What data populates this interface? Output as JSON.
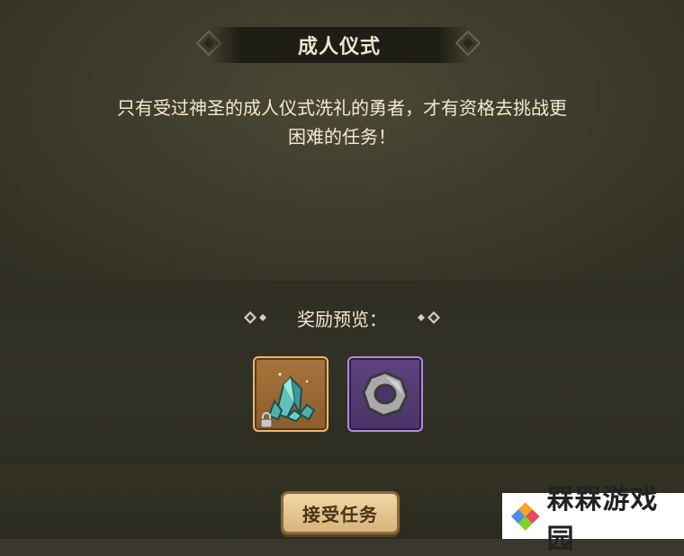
{
  "dialog": {
    "title": "成人仪式",
    "description_line1": "只有受过神圣的成人仪式洗礼的勇者，才有资格去挑战更",
    "description_line2": "困难的任务！"
  },
  "rewards": {
    "label": "奖励预览：",
    "items": [
      {
        "icon": "crystal-ore-icon",
        "frame": "bronze",
        "locked": true
      },
      {
        "icon": "stone-ring-icon",
        "frame": "purple",
        "locked": false
      }
    ]
  },
  "actions": {
    "accept_label": "接受任务"
  },
  "watermark": {
    "text": "槑槑游戏园"
  },
  "colors": {
    "text_cream": "#f3ead2",
    "bronze_frame": "#e8b86a",
    "purple_frame": "#b18ad8",
    "button_fill": "#e6c48e"
  }
}
